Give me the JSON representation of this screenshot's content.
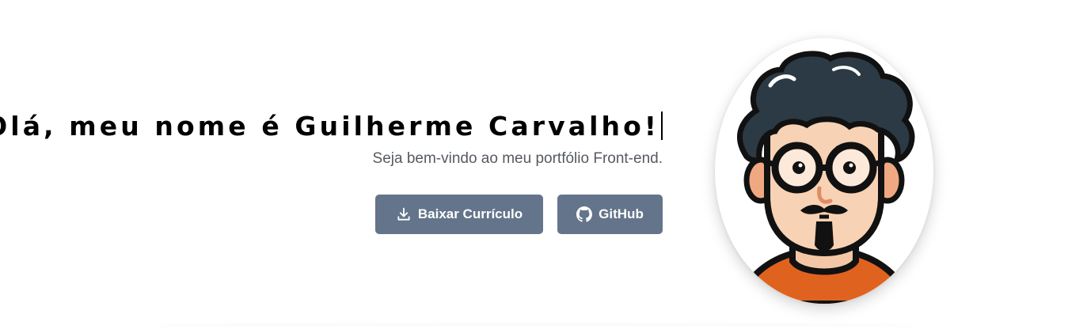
{
  "hero": {
    "headline": "Olá, meu nome é Guilherme Carvalho!",
    "subtitle": "Seja bem-vindo ao meu portfólio Front-end.",
    "buttons": [
      {
        "label": "Baixar Currículo",
        "icon": "download-icon"
      },
      {
        "label": "GitHub",
        "icon": "github-icon"
      }
    ]
  },
  "colors": {
    "button_bg": "#64748b",
    "button_text": "#ffffff",
    "headline": "#000000",
    "subtitle": "#555a60",
    "shirt": "#e0621f",
    "hair": "#2b3a44"
  }
}
